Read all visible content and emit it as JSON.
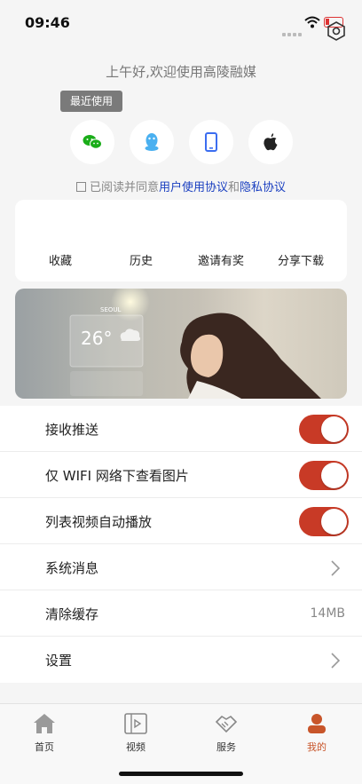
{
  "status_bar": {
    "time": "09:46"
  },
  "greeting": "上午好,欢迎使用高陵融媒",
  "recent_tag": "最近使用",
  "login_options": [
    {
      "name": "wechat",
      "color": "#1aad19"
    },
    {
      "name": "qq",
      "color": "#4ab0f0"
    },
    {
      "name": "phone",
      "color": "#3b6df0"
    },
    {
      "name": "apple",
      "color": "#222222"
    }
  ],
  "agreement": {
    "prefix": "已阅读并同意",
    "user_agreement": "用户使用协议",
    "and": "和",
    "privacy": "隐私协议"
  },
  "quick_actions": [
    "收藏",
    "历史",
    "邀请有奖",
    "分享下载"
  ],
  "banner": {
    "city": "SEOUL",
    "temperature": "26°"
  },
  "settings": [
    {
      "label": "接收推送",
      "type": "toggle",
      "on": true
    },
    {
      "label": "仅 WIFI 网络下查看图片",
      "type": "toggle",
      "on": true
    },
    {
      "label": "列表视频自动播放",
      "type": "toggle",
      "on": true
    },
    {
      "label": "系统消息",
      "type": "link"
    },
    {
      "label": "清除缓存",
      "type": "value",
      "value": "14MB"
    },
    {
      "label": "设置",
      "type": "link"
    }
  ],
  "tabs": [
    {
      "label": "首页",
      "active": false
    },
    {
      "label": "视频",
      "active": false
    },
    {
      "label": "服务",
      "active": false
    },
    {
      "label": "我的",
      "active": true
    }
  ],
  "colors": {
    "accent": "#c83a26",
    "link": "#1a3fc0",
    "tab_active": "#c8552a"
  }
}
